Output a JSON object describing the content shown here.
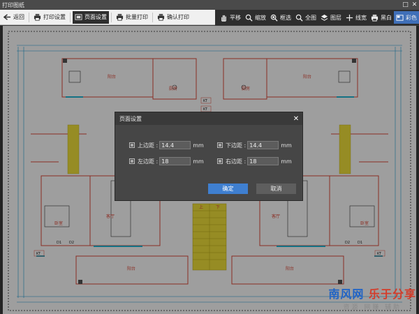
{
  "window": {
    "title": "打印图纸",
    "controls": {
      "maximize": "□",
      "close": "✕"
    }
  },
  "toolbar": {
    "left": [
      {
        "key": "back",
        "label": "返回",
        "icon": "back-arrow-icon"
      },
      {
        "key": "print-settings",
        "label": "打印设置",
        "icon": "printer-icon"
      },
      {
        "key": "page-settings",
        "label": "页面设置",
        "icon": "page-icon"
      },
      {
        "key": "batch-print",
        "label": "批量打印",
        "icon": "printer-icon"
      },
      {
        "key": "confirm-print",
        "label": "确认打印",
        "icon": "printer-icon"
      }
    ],
    "view": [
      {
        "key": "pan",
        "label": "平移",
        "icon": "hand-icon"
      },
      {
        "key": "zoom",
        "label": "缩放",
        "icon": "zoom-icon"
      },
      {
        "key": "box-select",
        "label": "框选",
        "icon": "magnifier-icon"
      },
      {
        "key": "full-view",
        "label": "全图",
        "icon": "magnifier-icon"
      },
      {
        "key": "layers",
        "label": "图层",
        "icon": "layers-icon"
      },
      {
        "key": "linewidth",
        "label": "线宽",
        "icon": "plus-icon"
      }
    ],
    "color_modes": [
      {
        "key": "black-white",
        "label": "黑白",
        "icon": "printer-icon",
        "active": false
      },
      {
        "key": "color",
        "label": "彩色",
        "icon": "palette-icon",
        "active": true
      }
    ]
  },
  "drawing": {
    "room_labels": [
      "阳台",
      "厨房",
      "厨房",
      "阳台",
      "卧室",
      "客厅",
      "客厅",
      "卧室",
      "阳台",
      "阳台"
    ],
    "tags": [
      "KT",
      "KT",
      "D1",
      "D2",
      "D1",
      "D2",
      "KT",
      "KT"
    ],
    "stair_marks": [
      "上",
      "下"
    ]
  },
  "dialog": {
    "title": "页面设置",
    "fields": {
      "top": {
        "label": "上边距 :",
        "value": "14.4",
        "unit": "mm"
      },
      "bottom": {
        "label": "下边距 :",
        "value": "14.4",
        "unit": "mm"
      },
      "left": {
        "label": "左边距 :",
        "value": "18",
        "unit": "mm"
      },
      "right": {
        "label": "右边距 :",
        "value": "18",
        "unit": "mm"
      }
    },
    "ok_label": "确定",
    "cancel_label": "取消"
  },
  "watermark": {
    "brand_blue": "南风网",
    "brand_red": "乐于分享",
    "subtitle": "资源 网赚 辅助"
  },
  "colors": {
    "accent": "#3f7fd0",
    "wall": "#e04a3a",
    "dim": "#1a9ed8",
    "stair": "#f3e33a",
    "dialog_bg": "#464646"
  }
}
